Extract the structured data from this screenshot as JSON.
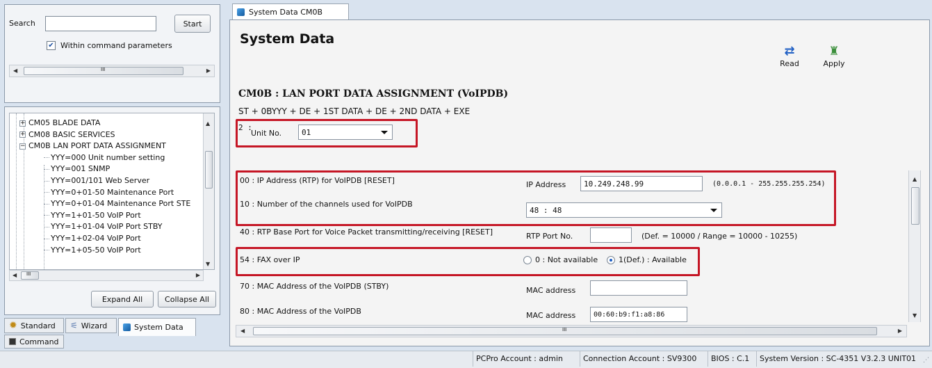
{
  "search": {
    "label": "Search",
    "value": "",
    "button": "Start",
    "within_checked": true,
    "within_label": "Within command parameters"
  },
  "hscroll_mark": "III",
  "tree": {
    "items": [
      {
        "label": "CM05 BLADE DATA",
        "level": 1,
        "expander": "plus"
      },
      {
        "label": "CM08 BASIC SERVICES",
        "level": 1,
        "expander": "plus"
      },
      {
        "label": "CM0B LAN PORT DATA ASSIGNMENT",
        "level": 1,
        "expander": "minus"
      },
      {
        "label": "YYY=000 Unit number setting",
        "level": 2
      },
      {
        "label": "YYY=001 SNMP",
        "level": 2
      },
      {
        "label": "YYY=001/101 Web Server",
        "level": 2
      },
      {
        "label": "YYY=0+01-50 Maintenance Port",
        "level": 2
      },
      {
        "label": "YYY=0+01-04 Maintenance Port STE",
        "level": 2
      },
      {
        "label": "YYY=1+01-50 VoIP Port",
        "level": 2
      },
      {
        "label": "YYY=1+01-04 VoIP Port STBY",
        "level": 2
      },
      {
        "label": "YYY=1+02-04 VoIP Port",
        "level": 2
      },
      {
        "label": "YYY=1+05-50 VoIP Port",
        "level": 2
      }
    ],
    "expand_all": "Expand All",
    "collapse_all": "Collapse All"
  },
  "bottom_tabs": [
    {
      "label": "Standard",
      "icon": "gear-icon"
    },
    {
      "label": "Wizard",
      "icon": "wand-icon"
    },
    {
      "label": "System Data",
      "icon": "cube-icon",
      "active": true
    }
  ],
  "command_tab": "Command",
  "doc_tab": "System Data CM0B",
  "page_title": "System Data",
  "toolbar": {
    "read": "Read",
    "apply": "Apply"
  },
  "cmd": {
    "title": "CM0B : LAN PORT DATA ASSIGNMENT (VoIPDB)",
    "syntax": "ST + 0BYYY + DE + 1ST DATA + DE + 2ND DATA + EXE",
    "unit_prefix": "2 :",
    "unit_label": "Unit No.",
    "unit_value": "01"
  },
  "rows": {
    "r00": {
      "label": "00 : IP Address (RTP) for VoIPDB [RESET]",
      "field_label": "IP Address",
      "value": "10.249.248.99",
      "hint": "(0.0.0.1 - 255.255.255.254)"
    },
    "r10": {
      "label": "10 : Number of the channels used for VoIPDB",
      "value": "48 : 48"
    },
    "r40": {
      "label": "40 : RTP Base Port for Voice Packet transmitting/receiving [RESET]",
      "field_label": "RTP Port No.",
      "value": "",
      "hint": "(Def. = 10000 / Range = 10000 - 10255)"
    },
    "r54": {
      "label": "54 : FAX over IP",
      "opt0": "0 : Not available",
      "opt1": "1(Def.) : Available",
      "selected": 1
    },
    "r70": {
      "label": "70 : MAC Address of the VoIPDB (STBY)",
      "field_label": "MAC address",
      "value": ""
    },
    "r80": {
      "label": "80 : MAC Address of the VoIPDB",
      "field_label": "MAC address",
      "value": "00:60:b9:f1:a8:86"
    }
  },
  "status": {
    "pcpro": "PCPro Account : admin",
    "conn": "Connection Account : SV9300",
    "bios": "BIOS : C.1",
    "version": "System Version : SC-4351 V3.2.3 UNIT01"
  },
  "colors": {
    "highlight_box": "#c51625",
    "accent": "#1f5fc4"
  }
}
